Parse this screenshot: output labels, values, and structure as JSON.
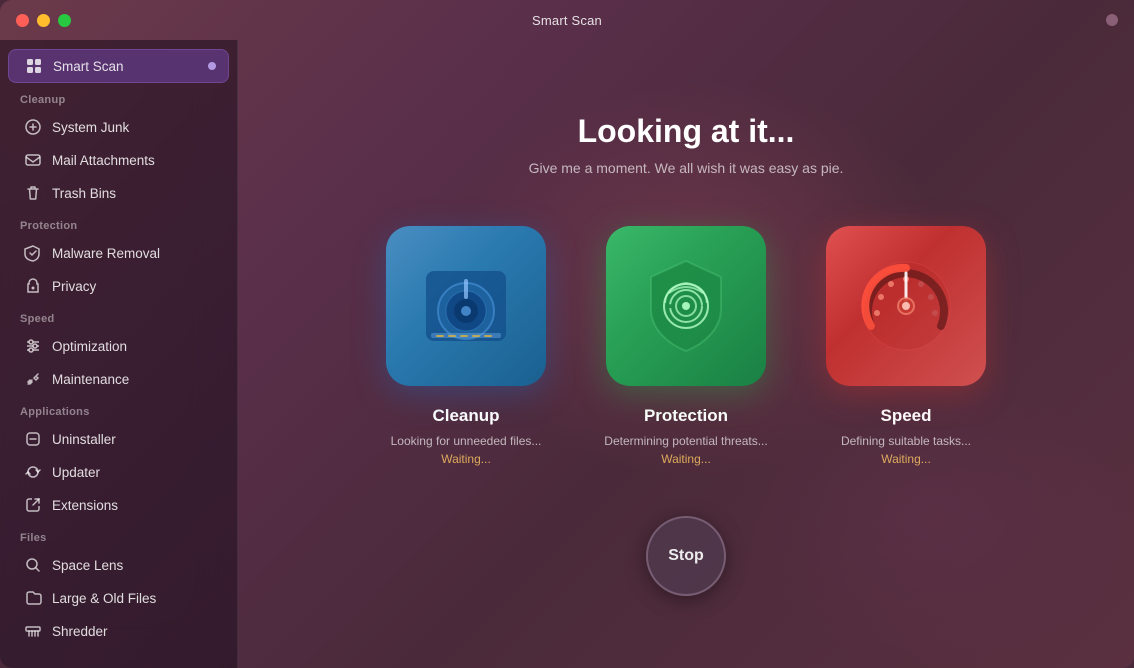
{
  "window": {
    "title": "Smart Scan"
  },
  "sidebar": {
    "active_item": "smart-scan",
    "smart_scan_label": "Smart Scan",
    "sections": [
      {
        "id": "cleanup",
        "label": "Cleanup",
        "items": [
          {
            "id": "system-junk",
            "label": "System Junk",
            "icon": "gear-icon"
          },
          {
            "id": "mail-attachments",
            "label": "Mail Attachments",
            "icon": "mail-icon"
          },
          {
            "id": "trash-bins",
            "label": "Trash Bins",
            "icon": "trash-icon"
          }
        ]
      },
      {
        "id": "protection",
        "label": "Protection",
        "items": [
          {
            "id": "malware-removal",
            "label": "Malware Removal",
            "icon": "bug-icon"
          },
          {
            "id": "privacy",
            "label": "Privacy",
            "icon": "hand-icon"
          }
        ]
      },
      {
        "id": "speed",
        "label": "Speed",
        "items": [
          {
            "id": "optimization",
            "label": "Optimization",
            "icon": "sliders-icon"
          },
          {
            "id": "maintenance",
            "label": "Maintenance",
            "icon": "wrench-icon"
          }
        ]
      },
      {
        "id": "applications",
        "label": "Applications",
        "items": [
          {
            "id": "uninstaller",
            "label": "Uninstaller",
            "icon": "uninstall-icon"
          },
          {
            "id": "updater",
            "label": "Updater",
            "icon": "refresh-icon"
          },
          {
            "id": "extensions",
            "label": "Extensions",
            "icon": "puzzle-icon"
          }
        ]
      },
      {
        "id": "files",
        "label": "Files",
        "items": [
          {
            "id": "space-lens",
            "label": "Space Lens",
            "icon": "circle-icon"
          },
          {
            "id": "large-old-files",
            "label": "Large & Old Files",
            "icon": "folder-icon"
          },
          {
            "id": "shredder",
            "label": "Shredder",
            "icon": "shred-icon"
          }
        ]
      }
    ]
  },
  "content": {
    "heading": "Looking at it...",
    "subheading": "Give me a moment. We all wish it was easy as pie.",
    "cards": [
      {
        "id": "cleanup",
        "title": "Cleanup",
        "status": "Looking for unneeded files...",
        "waiting": "Waiting..."
      },
      {
        "id": "protection",
        "title": "Protection",
        "status": "Determining potential threats...",
        "waiting": "Waiting..."
      },
      {
        "id": "speed",
        "title": "Speed",
        "status": "Defining suitable tasks...",
        "waiting": "Waiting..."
      }
    ],
    "stop_button_label": "Stop"
  }
}
